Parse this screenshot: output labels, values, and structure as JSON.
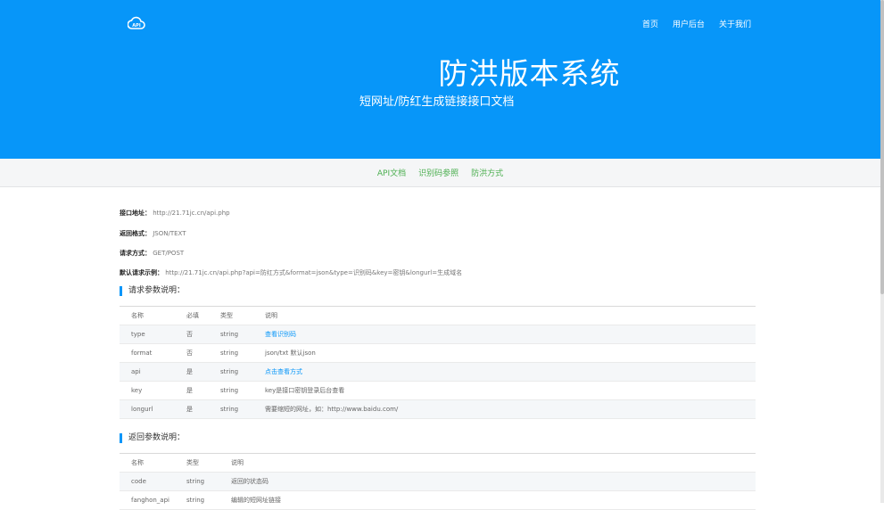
{
  "header": {
    "logo_text": "API",
    "nav": [
      "首页",
      "用户后台",
      "关于我们"
    ],
    "title": "防洪版本系统",
    "subtitle": "短网址/防红生成链接接口文档"
  },
  "subnav": [
    "API文档",
    "识别码参照",
    "防洪方式"
  ],
  "info": [
    {
      "label": "接口地址：",
      "value": "http://21.71jc.cn/api.php"
    },
    {
      "label": "返回格式：",
      "value": "JSON/TEXT"
    },
    {
      "label": "请求方式：",
      "value": "GET/POST"
    },
    {
      "label": "默认请求示例：",
      "value": "http://21.71jc.cn/api.php?api=防红方式&format=json&type=识别码&key=密钥&longurl=生成域名"
    }
  ],
  "request_params": {
    "title": "请求参数说明：",
    "headers": [
      "名称",
      "必填",
      "类型",
      "说明"
    ],
    "rows": [
      [
        "type",
        "否",
        "string",
        "查看识别码"
      ],
      [
        "format",
        "否",
        "string",
        "json/txt 默认json"
      ],
      [
        "api",
        "是",
        "string",
        "点击查看方式"
      ],
      [
        "key",
        "是",
        "string",
        "key是接口密钥登录后台查看"
      ],
      [
        "longurl",
        "是",
        "string",
        "需要缩短的网址，如：http://www.baidu.com/"
      ]
    ]
  },
  "return_params": {
    "title": "返回参数说明：",
    "headers": [
      "名称",
      "类型",
      "说明"
    ],
    "rows": [
      [
        "code",
        "string",
        "返回的状态码"
      ],
      [
        "fanghon_api",
        "string",
        "编辑的短网址链接"
      ]
    ]
  },
  "colors": {
    "brand": "#0796f9",
    "subnav_link": "#4caf50"
  }
}
